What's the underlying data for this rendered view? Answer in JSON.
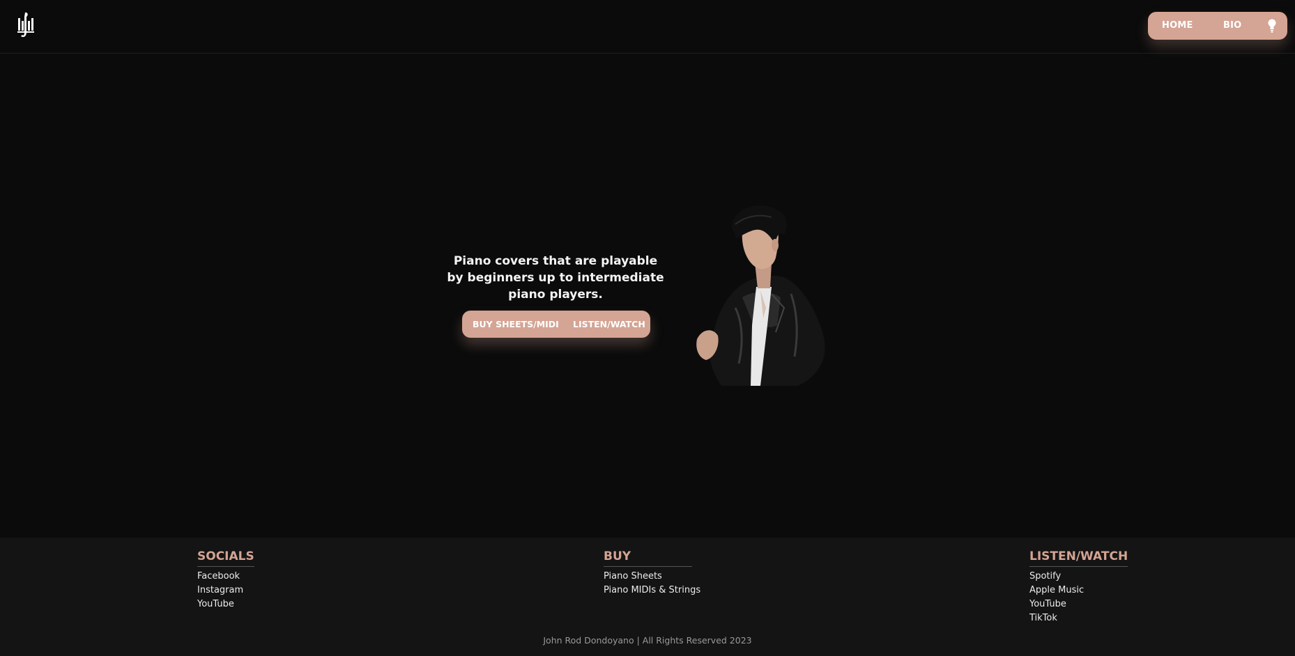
{
  "header": {
    "logo_icon": "piano-keys-logo-icon",
    "nav": {
      "home": "HOME",
      "bio": "BIO",
      "theme_icon": "lightbulb-icon"
    }
  },
  "hero": {
    "tagline": "Piano covers that are playable by beginners up to intermediate piano players.",
    "buttons": {
      "buy": "BUY SHEETS/MIDI",
      "listen": "LISTEN/WATCH"
    },
    "image_icon": "artist-portrait"
  },
  "footer": {
    "socials": {
      "heading": "SOCIALS",
      "links": [
        "Facebook",
        "Instagram",
        "YouTube"
      ]
    },
    "buy": {
      "heading": "BUY",
      "links": [
        "Piano Sheets",
        "Piano MIDIs & Strings"
      ]
    },
    "listen": {
      "heading": "LISTEN/WATCH",
      "links": [
        "Spotify",
        "Apple Music",
        "YouTube",
        "TikTok"
      ]
    },
    "copyright": "John Rod Dondoyano | All Rights Reserved 2023"
  },
  "colors": {
    "background": "#0b0b0b",
    "accent": "#d4a494",
    "footer_bg": "#141414"
  }
}
